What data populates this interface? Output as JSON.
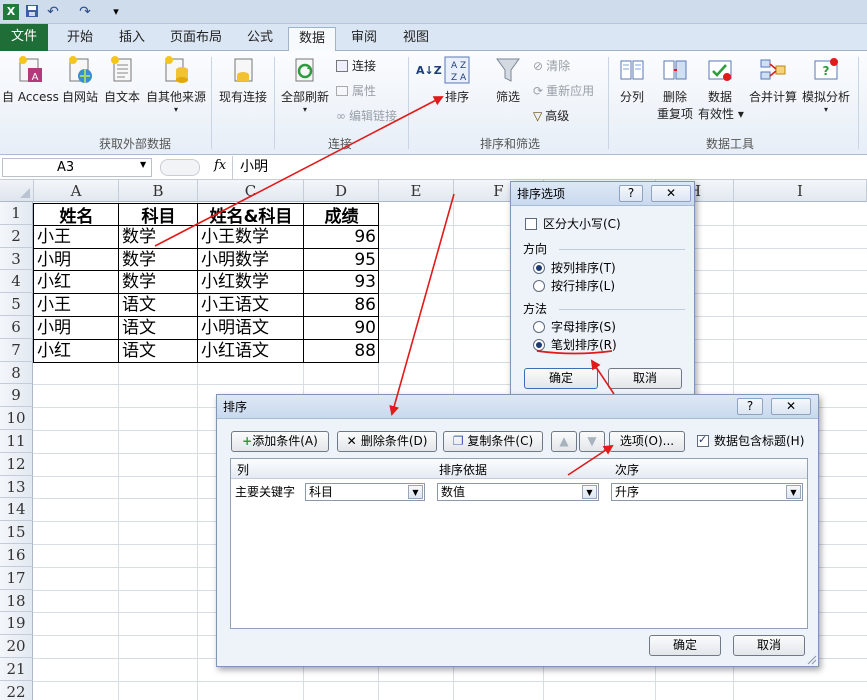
{
  "quick_access": {
    "excel_icon": "X",
    "save_icon": "save-icon",
    "undo_icon": "↶",
    "redo_icon": "↷",
    "customize_icon": "▾"
  },
  "tabs": {
    "file": "文件",
    "items": [
      "开始",
      "插入",
      "页面布局",
      "公式",
      "数据",
      "审阅",
      "视图"
    ],
    "active": "数据"
  },
  "ribbon": {
    "get_external": {
      "access": "自 Access",
      "web": "自网站",
      "text": "自文本",
      "other": "自其他来源",
      "existing": "现有连接",
      "group": "获取外部数据"
    },
    "connections": {
      "refresh": "全部刷新",
      "connections": "连接",
      "properties": "属性",
      "edit_links": "编辑链接",
      "group": "连接"
    },
    "sort_filter": {
      "sort_az": "A↓Z",
      "sort": "排序",
      "filter": "筛选",
      "clear": "清除",
      "reapply": "重新应用",
      "advanced": "高级",
      "group": "排序和筛选"
    },
    "data_tools": {
      "split": "分列",
      "remove_dup_1": "删除",
      "remove_dup_2": "重复项",
      "validation_1": "数据",
      "validation_2": "有效性",
      "consolidate": "合并计算",
      "whatif": "模拟分析",
      "group": "数据工具"
    }
  },
  "formula_bar": {
    "name_box": "A3",
    "fx": "fx",
    "value": "小明"
  },
  "columns": [
    "A",
    "B",
    "C",
    "D",
    "E",
    "F",
    "G",
    "H",
    "I"
  ],
  "rows": [
    "1",
    "2",
    "3",
    "4",
    "5",
    "6",
    "7",
    "8",
    "9",
    "10",
    "11",
    "12",
    "13",
    "14",
    "15",
    "16",
    "17",
    "18",
    "19",
    "20",
    "21",
    "22"
  ],
  "table": {
    "header": [
      "姓名",
      "科目",
      "姓名&科目",
      "成绩"
    ],
    "rows": [
      [
        "小王",
        "数学",
        "小王数学",
        "96"
      ],
      [
        "小明",
        "数学",
        "小明数学",
        "95"
      ],
      [
        "小红",
        "数学",
        "小红数学",
        "93"
      ],
      [
        "小王",
        "语文",
        "小王语文",
        "86"
      ],
      [
        "小明",
        "语文",
        "小明语文",
        "90"
      ],
      [
        "小红",
        "语文",
        "小红语文",
        "88"
      ]
    ]
  },
  "sort_options": {
    "title": "排序选项",
    "help": "?",
    "close": "✕",
    "case_sensitive": "区分大小写(C)",
    "direction_label": "方向",
    "by_column": "按列排序(T)",
    "by_row": "按行排序(L)",
    "method_label": "方法",
    "by_letter": "字母排序(S)",
    "by_stroke": "笔划排序(R)",
    "ok": "确定",
    "cancel": "取消"
  },
  "sort_dialog": {
    "title": "排序",
    "help": "?",
    "close": "✕",
    "add_level": "添加条件(A)",
    "delete_level": "删除条件(D)",
    "copy_level": "复制条件(C)",
    "up": "▲",
    "down": "▼",
    "options": "选项(O)...",
    "has_headers": "数据包含标题(H)",
    "col_header": "列",
    "sort_on_header": "排序依据",
    "order_header": "次序",
    "primary_key": "主要关键字",
    "column_value": "科目",
    "sort_on_value": "数值",
    "order_value": "升序",
    "ok": "确定",
    "cancel": "取消"
  },
  "colors": {
    "annotation": "#e11a1a",
    "file_tab": "#1f6d37"
  }
}
